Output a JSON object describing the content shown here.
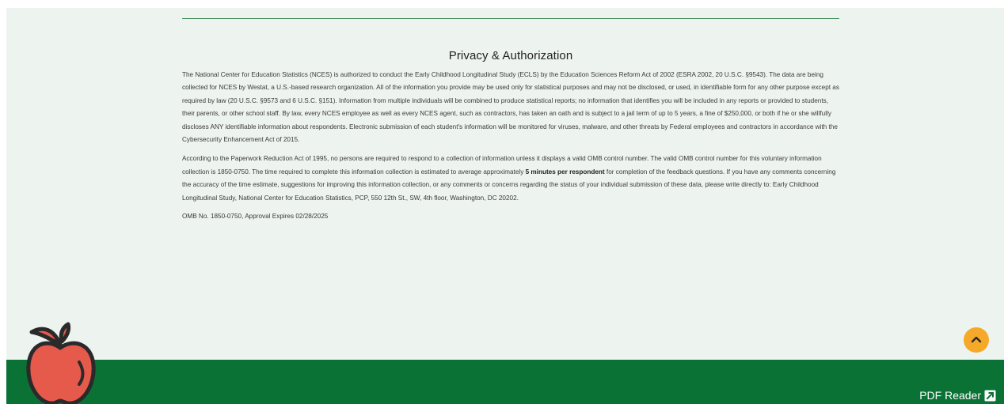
{
  "privacy": {
    "title": "Privacy & Authorization",
    "para1": "The National Center for Education Statistics (NCES) is authorized to conduct the Early Childhood Longitudinal Study (ECLS) by the Education Sciences Reform Act of 2002 (ESRA 2002, 20 U.S.C. §9543). The data are being collected for NCES by Westat, a U.S.-based research organization. All of the information you provide may be used only for statistical purposes and may not be disclosed, or used, in identifiable form for any other purpose except as required by law (20 U.S.C. §9573 and 6 U.S.C. §151). Information from multiple individuals will be combined to produce statistical reports; no information that identifies you will be included in any reports or provided to students, their parents, or other school staff. By law, every NCES employee as well as every NCES agent, such as contractors, has taken an oath and is subject to a jail term of up to 5 years, a fine of $250,000, or both if he or she willfully discloses ANY identifiable information about respondents. Electronic submission of each student's information will be monitored for viruses, malware, and other threats by Federal employees and contractors in accordance with the Cybersecurity Enhancement Act of 2015.",
    "para2_before": "According to the Paperwork Reduction Act of 1995, no persons are required to respond to a collection of information unless it displays a valid OMB control number. The valid OMB control number for this voluntary information collection is 1850-0750. The time required to complete this information collection is estimated to average approximately ",
    "para2_bold": "5 minutes per respondent",
    "para2_after": " for completion of the feedback questions. If you have any comments concerning the accuracy of the time estimate, suggestions for improving this information collection, or any comments or concerns regarding the status of your individual submission of these data, please write directly to: Early Childhood Longitudinal Study, National Center for Education Statistics, PCP, 550 12th St., SW, 4th floor, Washington, DC 20202.",
    "omb": "OMB No. 1850-0750, Approval Expires 02/28/2025"
  },
  "footer": {
    "pdf_reader_label": "PDF Reader"
  },
  "icons": {
    "apple": "apple-icon",
    "external_link": "external-link-icon",
    "scroll_top": "chevron-up-icon"
  },
  "colors": {
    "background": "#edf3ef",
    "footer_green": "#0b7236",
    "divider_green": "#3f8a55",
    "apple_red": "#e65a4c",
    "scroll_button": "#f6a928"
  }
}
